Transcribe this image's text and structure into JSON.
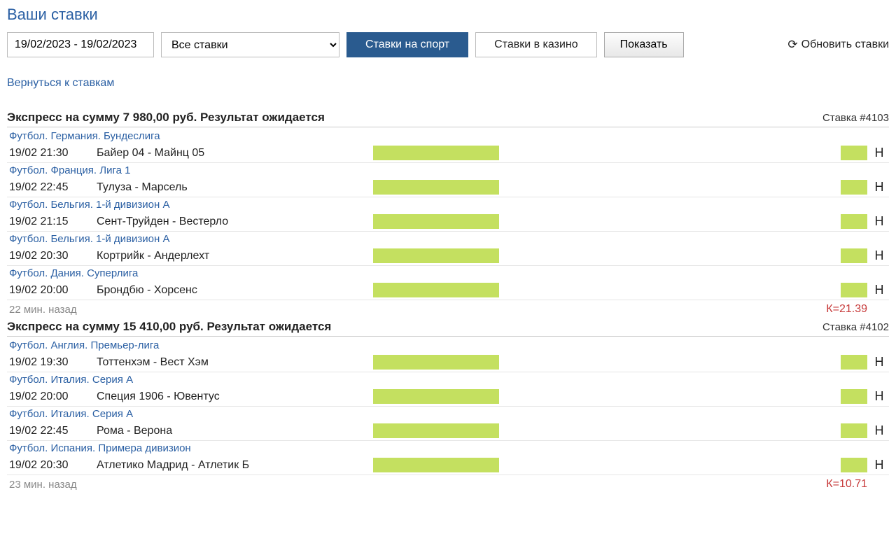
{
  "title": "Ваши ставки",
  "filters": {
    "date_range": "19/02/2023 - 19/02/2023",
    "bet_filter": "Все ставки",
    "tab_sport": "Ставки на спорт",
    "tab_casino": "Ставки в казино",
    "show_btn": "Показать",
    "refresh": "Обновить ставки"
  },
  "back_link": "Вернуться к ставкам",
  "bets": [
    {
      "title": "Экспресс на сумму 7 980,00 руб. Результат ожидается",
      "id": "Ставка #4103",
      "rows": [
        {
          "league": "Футбол. Германия. Бундеслига"
        },
        {
          "time": "19/02 21:30",
          "teams": "Байер 04 - Майнц 05",
          "h": "Н"
        },
        {
          "league": "Футбол. Франция. Лига 1"
        },
        {
          "time": "19/02 22:45",
          "teams": "Тулуза - Марсель",
          "h": "Н"
        },
        {
          "league": "Футбол. Бельгия. 1-й дивизион А"
        },
        {
          "time": "19/02 21:15",
          "teams": "Сент-Труйден - Вестерло",
          "h": "Н"
        },
        {
          "league": "Футбол. Бельгия. 1-й дивизион А"
        },
        {
          "time": "19/02 20:30",
          "teams": "Кортрийк - Андерлехт",
          "h": "Н"
        },
        {
          "league": "Футбол. Дания. Суперлига"
        },
        {
          "time": "19/02 20:00",
          "teams": "Брондбю - Хорсенс",
          "h": "Н"
        }
      ],
      "time_ago": "22 мин. назад",
      "coef": "К=21.39"
    },
    {
      "title": "Экспресс на сумму 15 410,00 руб. Результат ожидается",
      "id": "Ставка #4102",
      "rows": [
        {
          "league": "Футбол. Англия. Премьер-лига"
        },
        {
          "time": "19/02 19:30",
          "teams": "Тоттенхэм - Вест Хэм",
          "h": "Н"
        },
        {
          "league": "Футбол. Италия. Серия А"
        },
        {
          "time": "19/02 20:00",
          "teams": "Специя 1906 - Ювентус",
          "h": "Н"
        },
        {
          "league": "Футбол. Италия. Серия А"
        },
        {
          "time": "19/02 22:45",
          "teams": "Рома - Верона",
          "h": "Н"
        },
        {
          "league": "Футбол. Испания. Примера дивизион"
        },
        {
          "time": "19/02 20:30",
          "teams": "Атлетико Мадрид - Атлетик Б",
          "h": "Н"
        }
      ],
      "time_ago": "23 мин. назад",
      "coef": "К=10.71"
    }
  ]
}
